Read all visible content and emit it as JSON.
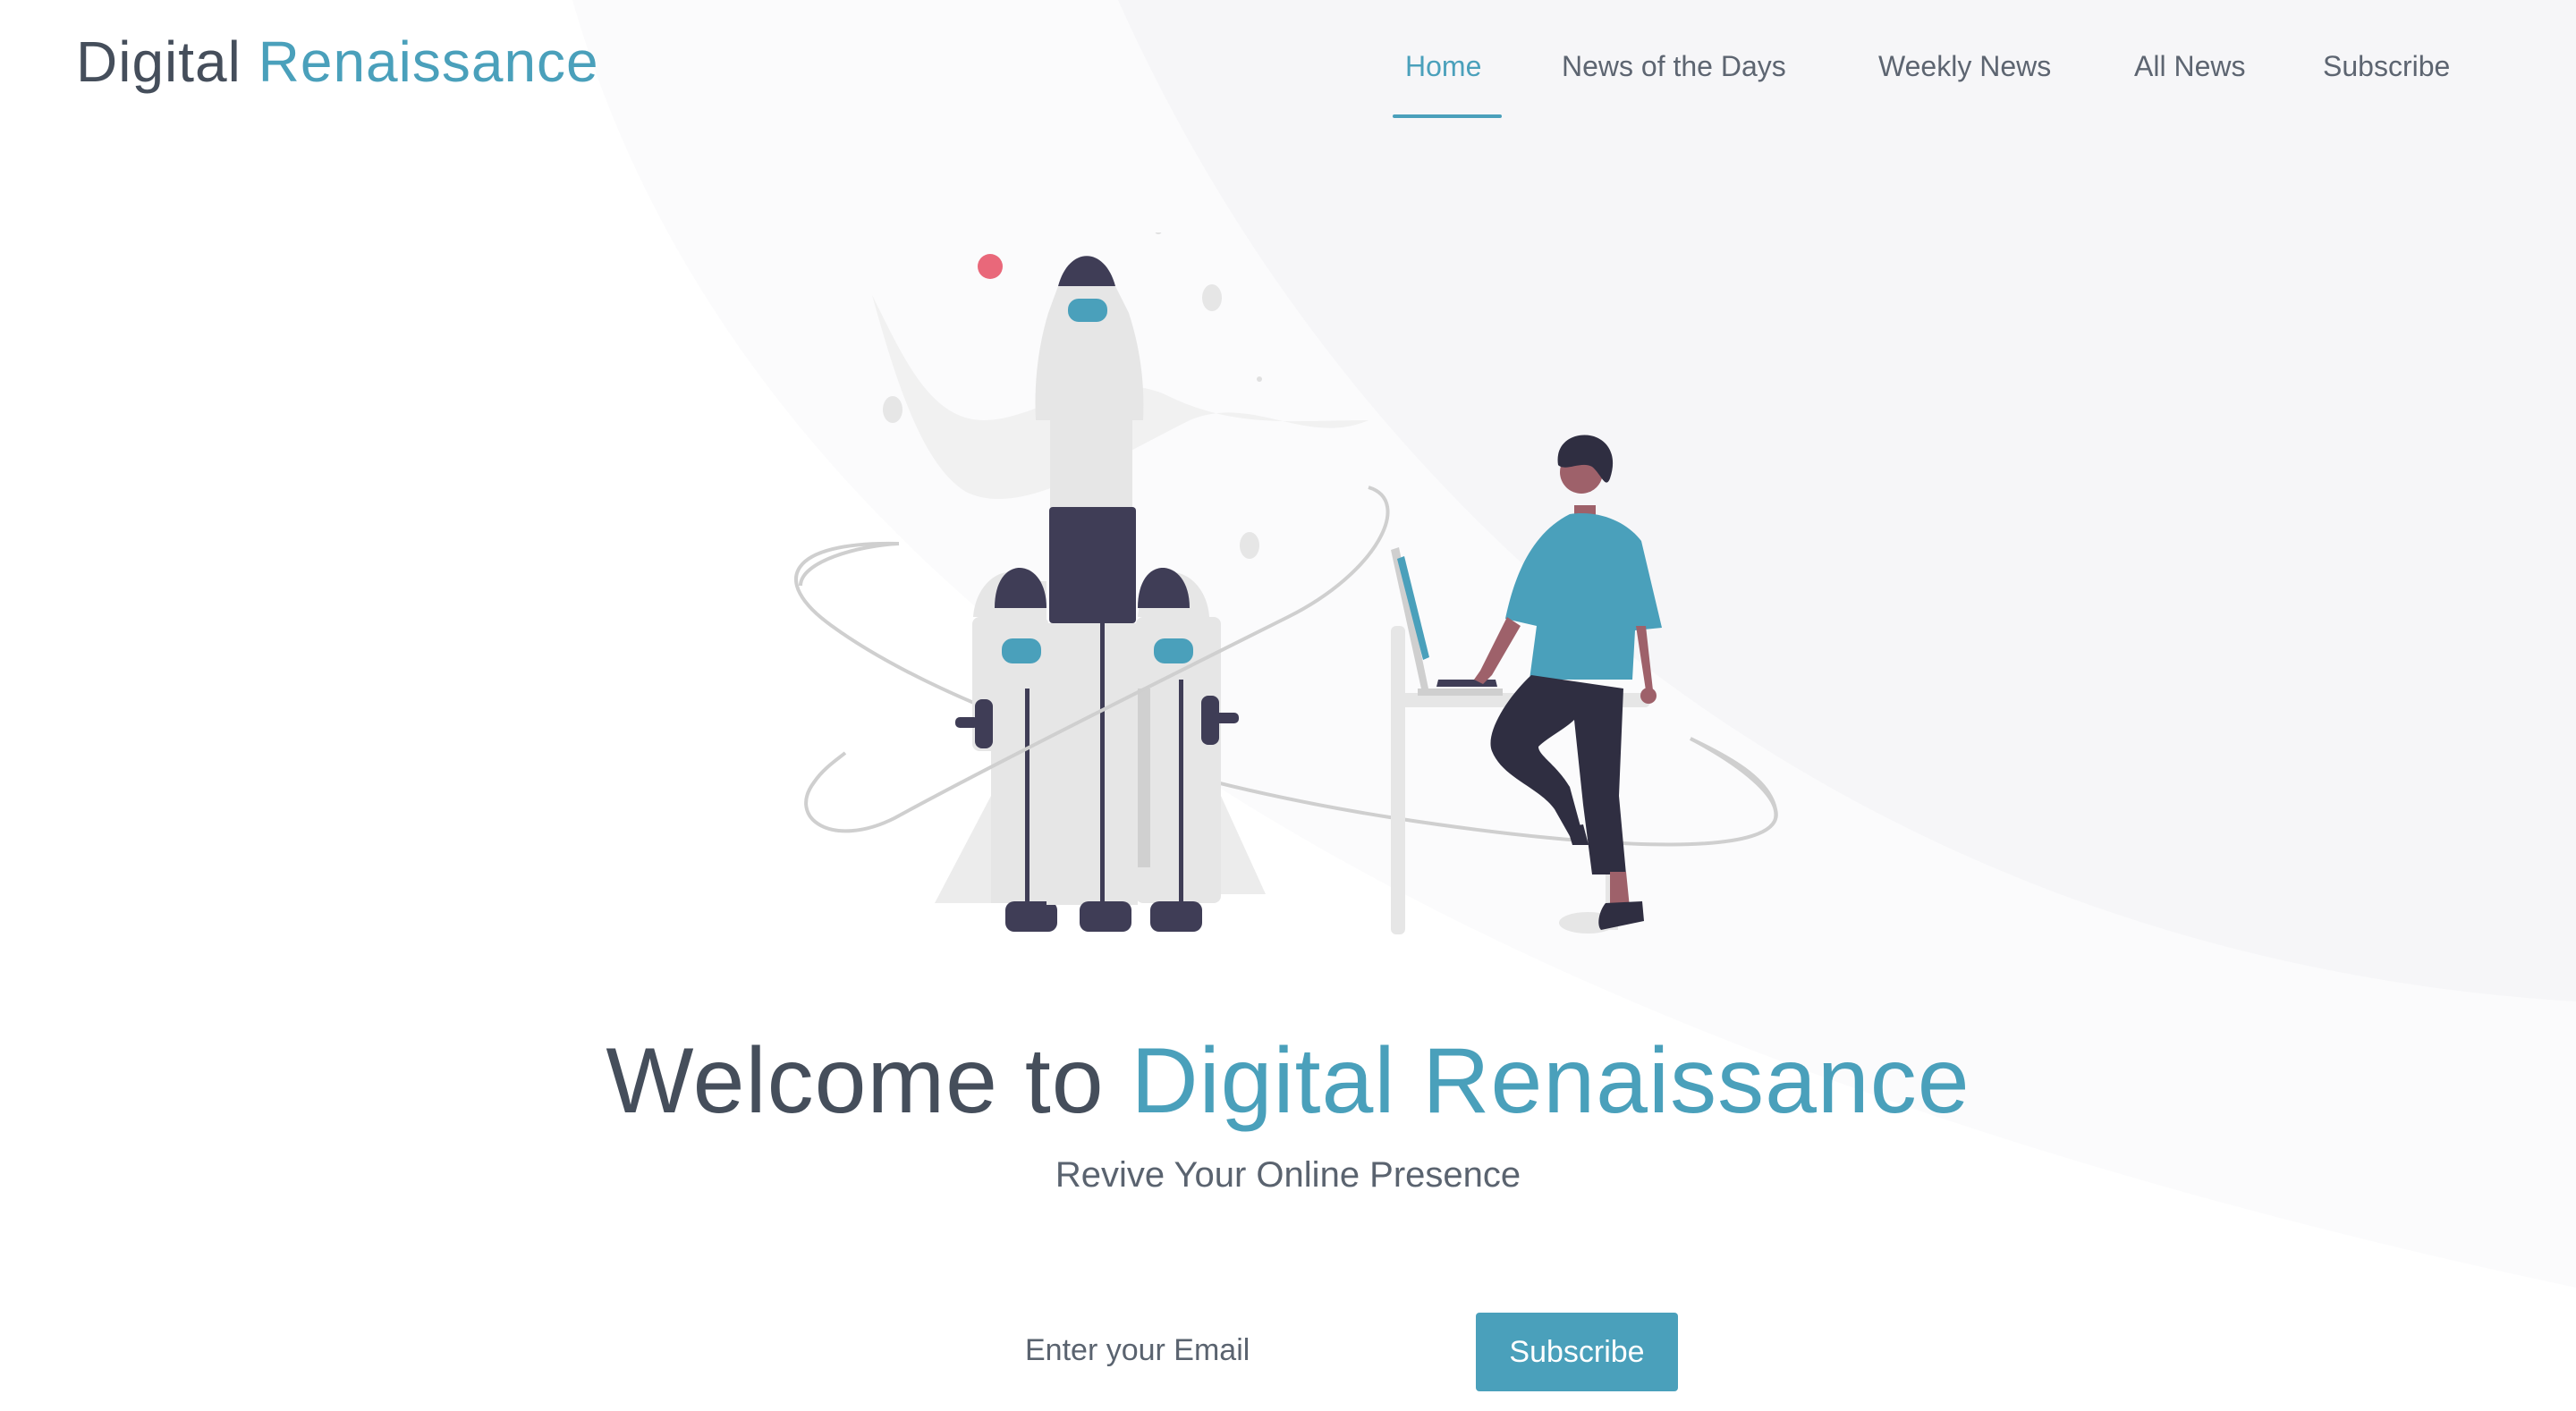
{
  "brand": {
    "name_part1": "Digital",
    "name_part2": "Renaissance"
  },
  "nav": {
    "items": [
      {
        "label": "Home",
        "active": true
      },
      {
        "label": "News of the Days",
        "active": false
      },
      {
        "label": "Weekly News",
        "active": false
      },
      {
        "label": "All News",
        "active": false
      },
      {
        "label": "Subscribe",
        "active": false
      }
    ]
  },
  "hero": {
    "title_part1": "Welcome to",
    "title_part2": "Digital Renaissance",
    "tagline": "Revive Your Online Presence",
    "illustration": "rocket-launch-illustration"
  },
  "subscribe": {
    "email_placeholder": "Enter your Email",
    "button_label": "Subscribe"
  },
  "colors": {
    "accent": "#4aa0bb",
    "text_dark": "#454e5b",
    "text_muted": "#5d6571",
    "illustration_dark": "#3f3d56",
    "illustration_light": "#e6e6e6",
    "dot_pink": "#e9687a"
  }
}
